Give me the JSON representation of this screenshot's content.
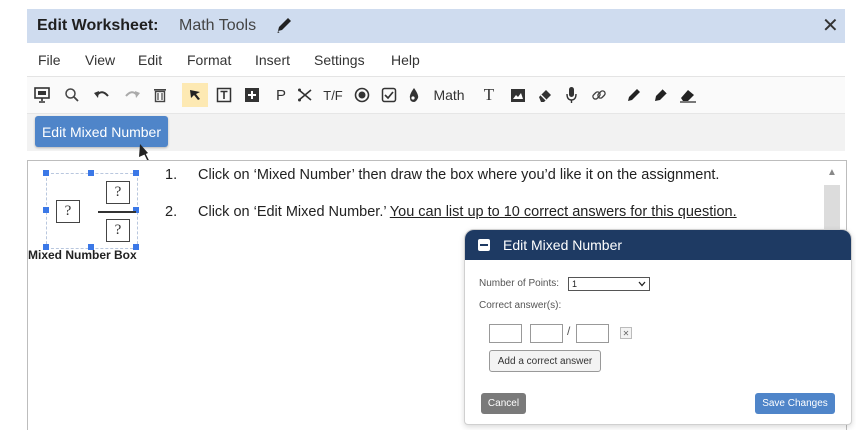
{
  "window": {
    "title_label": "Edit Worksheet:",
    "title_name": "Math Tools",
    "close_symbol": "✕"
  },
  "menu": [
    "File",
    "View",
    "Edit",
    "Format",
    "Insert",
    "Settings",
    "Help"
  ],
  "toolbar": {
    "tf_label": "T/F",
    "math_label": "Math",
    "p_label": "P",
    "t_label": "T"
  },
  "subbar": {
    "edit_button": "Edit Mixed Number"
  },
  "widget": {
    "placeholder": "?",
    "label": "Mixed Number Box"
  },
  "instructions": [
    {
      "num": "1.",
      "text": "Click on ‘Mixed Number’ then draw the box where you’d like it on the assignment."
    },
    {
      "num": "2.",
      "text_plain": "Click on ‘Edit Mixed Number.’ ",
      "text_underlined": "You can list up to 10 correct answers for this question."
    }
  ],
  "dialog": {
    "title": "Edit Mixed Number",
    "points_label": "Number of Points:",
    "points_value": "1",
    "answers_label": "Correct answer(s):",
    "slash": "/",
    "remove_symbol": "✕",
    "add_button": "Add a correct answer",
    "cancel_button": "Cancel",
    "save_button": "Save Changes"
  },
  "colors": {
    "title_bar": "#cfdcef",
    "accent_button": "#4f85c9",
    "dialog_header": "#1e3a63",
    "active_tool": "#fde9b3",
    "selection_handle": "#3b78e7"
  }
}
